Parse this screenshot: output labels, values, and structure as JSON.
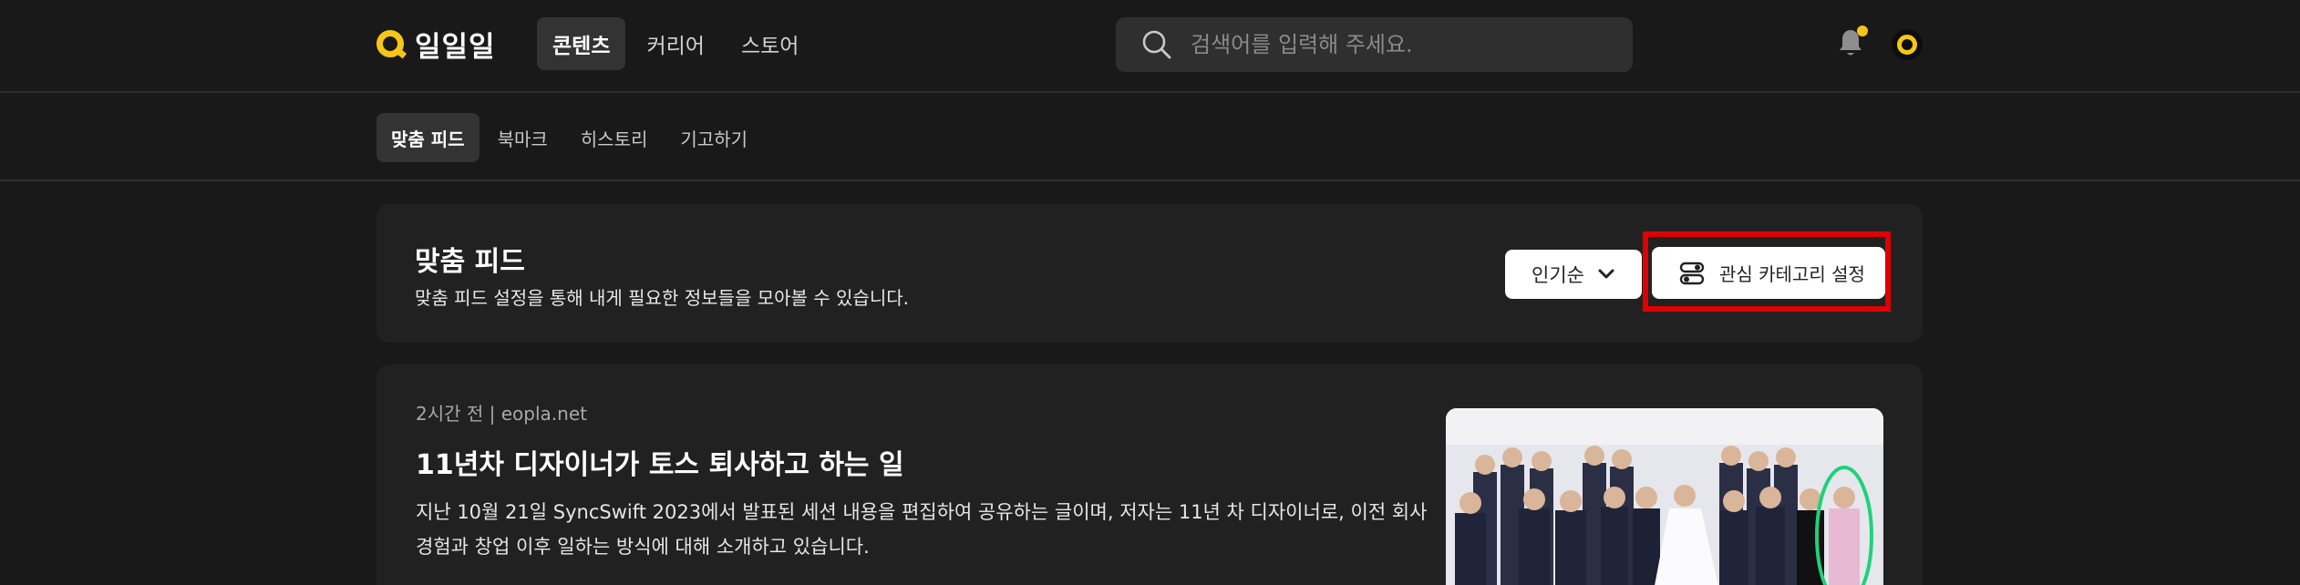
{
  "brand": {
    "name": "일일일"
  },
  "main_nav": {
    "tabs": [
      {
        "label": "콘텐츠",
        "active": true
      },
      {
        "label": "커리어",
        "active": false
      },
      {
        "label": "스토어",
        "active": false
      }
    ]
  },
  "search": {
    "placeholder": "검색어를 입력해 주세요.",
    "value": ""
  },
  "notifications": {
    "has_unread": true
  },
  "sub_nav": {
    "tabs": [
      {
        "label": "맞춤 피드",
        "active": true
      },
      {
        "label": "북마크",
        "active": false
      },
      {
        "label": "히스토리",
        "active": false
      },
      {
        "label": "기고하기",
        "active": false
      }
    ]
  },
  "feed_header": {
    "title": "맞춤 피드",
    "description": "맞춤 피드 설정을 통해 내게 필요한 정보들을 모아볼 수 있습니다.",
    "sort_label": "인기순",
    "category_button_label": "관심 카테고리 설정"
  },
  "article": {
    "meta": "2시간 전 | eopla.net",
    "title": "11년차 디자이너가 토스 퇴사하고 하는 일",
    "summary": "지난 10월 21일 SyncSwift 2023에서 발표된 세션 내용을 편집하여 공유하는 글이며, 저자는 11년 차 디자이너로, 이전 회사 경험과 창업 이후 일하는 방식에 대해 소개하고 있습니다."
  },
  "colors": {
    "background": "#191919",
    "card": "#212121",
    "accent": "#f5c518",
    "highlight": "#e00000"
  }
}
